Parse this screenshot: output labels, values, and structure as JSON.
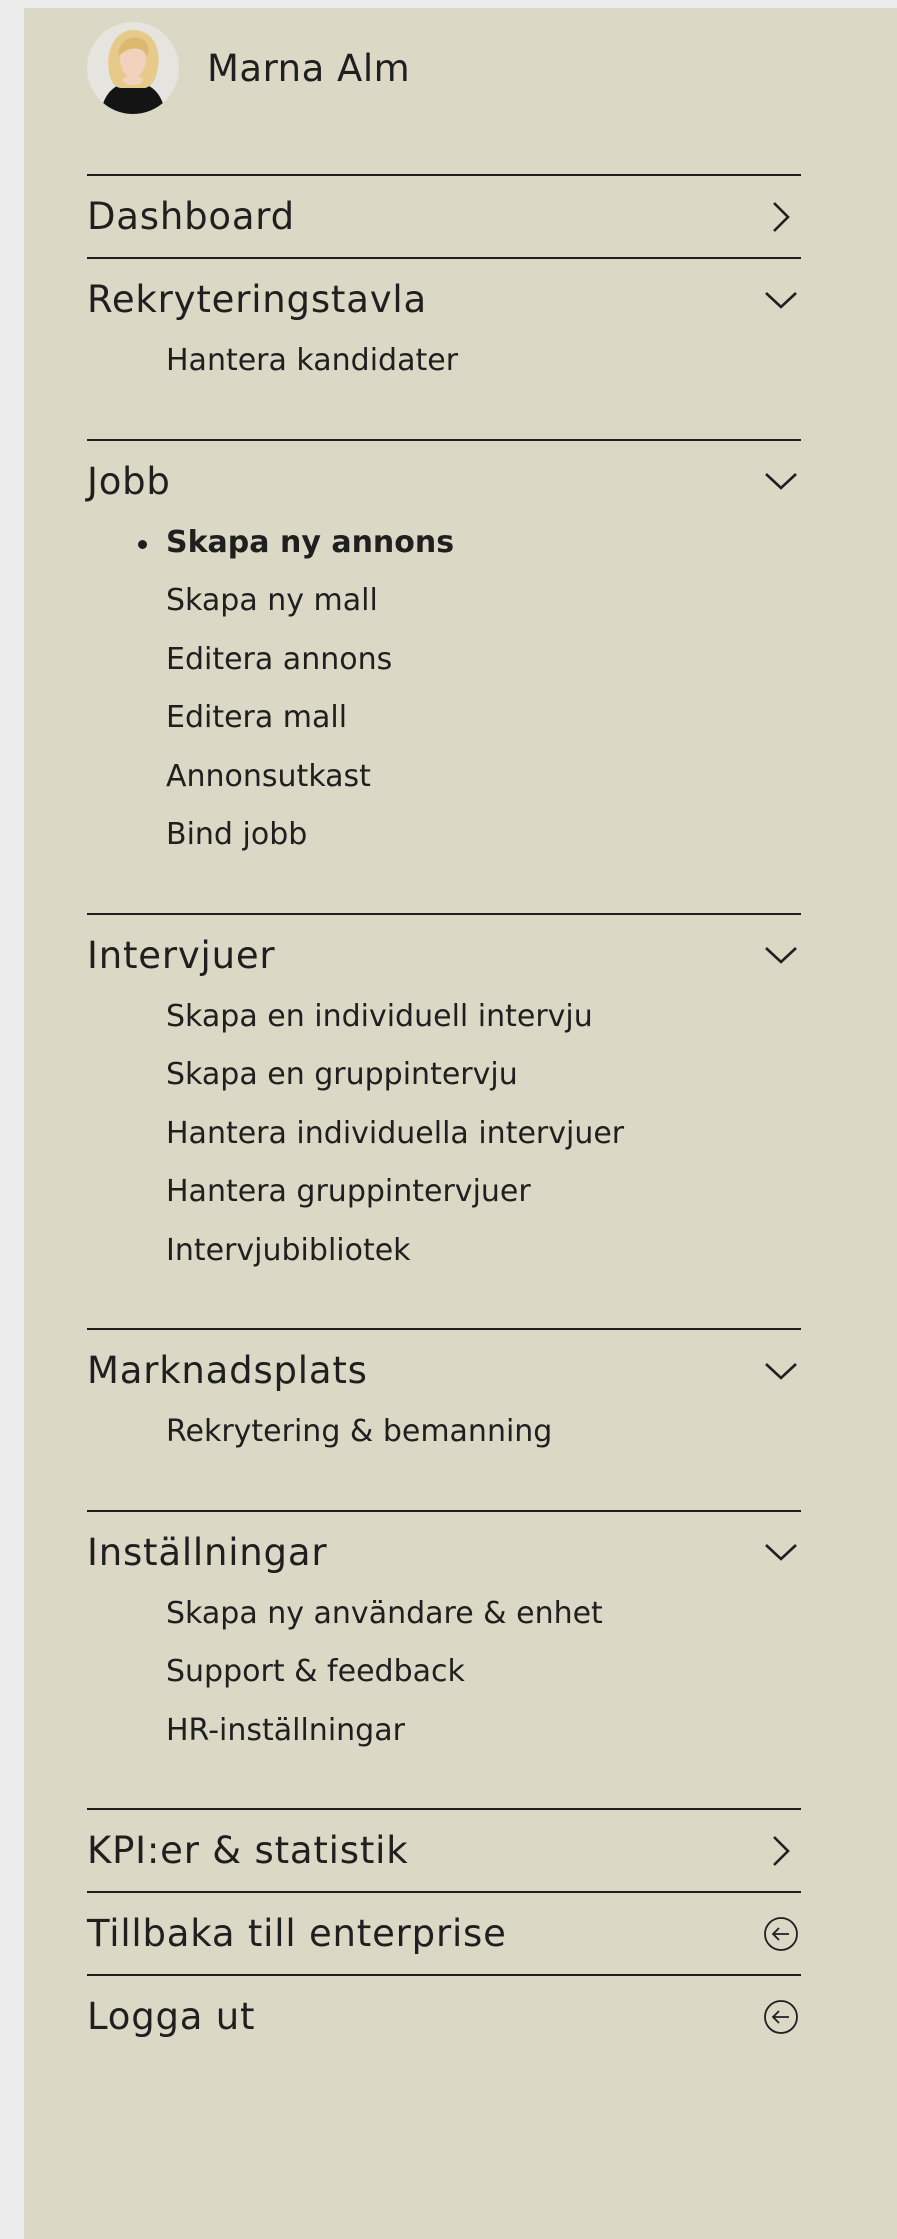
{
  "user": {
    "name": "Marna Alm"
  },
  "nav": {
    "dashboard": {
      "label": "Dashboard",
      "icon": "chevron-right-icon"
    },
    "rekrytering": {
      "label": "Rekryteringstavla",
      "icon": "chevron-down-icon",
      "items": [
        "Hantera kandidater"
      ]
    },
    "jobb": {
      "label": "Jobb",
      "icon": "chevron-down-icon",
      "active_item": "Skapa ny annons",
      "items": [
        "Skapa ny annons",
        "Skapa ny mall",
        "Editera annons",
        "Editera mall",
        "Annonsutkast",
        "Bind jobb"
      ]
    },
    "intervjuer": {
      "label": "Intervjuer",
      "icon": "chevron-down-icon",
      "items": [
        "Skapa en individuell intervju",
        "Skapa en gruppintervju",
        "Hantera individuella intervjuer",
        "Hantera gruppintervjuer",
        "Intervjubibliotek"
      ]
    },
    "marknadsplats": {
      "label": "Marknadsplats",
      "icon": "chevron-down-icon",
      "items": [
        "Rekrytering & bemanning"
      ]
    },
    "installningar": {
      "label": "Inställningar",
      "icon": "chevron-down-icon",
      "items": [
        "Skapa ny användare & enhet",
        "Support & feedback",
        "HR-inställningar"
      ]
    },
    "kpi": {
      "label": "KPI:er & statistik",
      "icon": "chevron-right-icon"
    },
    "tillbaka": {
      "label": "Tillbaka till enterprise",
      "icon": "circle-arrow-left-icon"
    },
    "logout": {
      "label": "Logga ut",
      "icon": "circle-arrow-left-icon"
    }
  },
  "colors": {
    "panel_bg": "#dbd8c6",
    "page_bg": "#ececec",
    "text": "#1f1f1f"
  }
}
